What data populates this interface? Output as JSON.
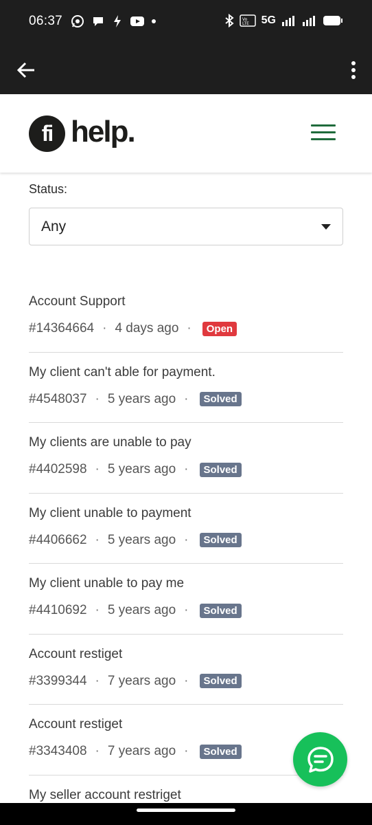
{
  "status_bar": {
    "time": "06:37",
    "network": "5G",
    "volte": "Vo LTE"
  },
  "app": {
    "brand_mark": "fi",
    "brand_text": "help."
  },
  "filter": {
    "label": "Status:",
    "selected": "Any"
  },
  "requests": [
    {
      "title": "Account Support",
      "id": "#14364664",
      "age": "4 days ago",
      "status": "Open",
      "status_kind": "open"
    },
    {
      "title": "My client can't able for payment.",
      "id": "#4548037",
      "age": "5 years ago",
      "status": "Solved",
      "status_kind": "solved"
    },
    {
      "title": "My clients are unable to pay",
      "id": "#4402598",
      "age": "5 years ago",
      "status": "Solved",
      "status_kind": "solved"
    },
    {
      "title": "My client unable to payment",
      "id": "#4406662",
      "age": "5 years ago",
      "status": "Solved",
      "status_kind": "solved"
    },
    {
      "title": "My client unable to pay me",
      "id": "#4410692",
      "age": "5 years ago",
      "status": "Solved",
      "status_kind": "solved"
    },
    {
      "title": "Account restiget",
      "id": "#3399344",
      "age": "7 years ago",
      "status": "Solved",
      "status_kind": "solved"
    },
    {
      "title": "Account restiget",
      "id": "#3343408",
      "age": "7 years ago",
      "status": "Solved",
      "status_kind": "solved"
    },
    {
      "title": "My seller account restriget",
      "id": "",
      "age": "",
      "status": "",
      "status_kind": ""
    }
  ],
  "colors": {
    "open": "#e0393e",
    "solved": "#68758c",
    "brand_green": "#1f6b3b",
    "chat_green": "#17c05a"
  },
  "icons": {
    "back": "arrow-left-icon",
    "more": "more-vertical-icon",
    "menu": "hamburger-menu-icon",
    "chat": "chat-bubble-icon"
  }
}
